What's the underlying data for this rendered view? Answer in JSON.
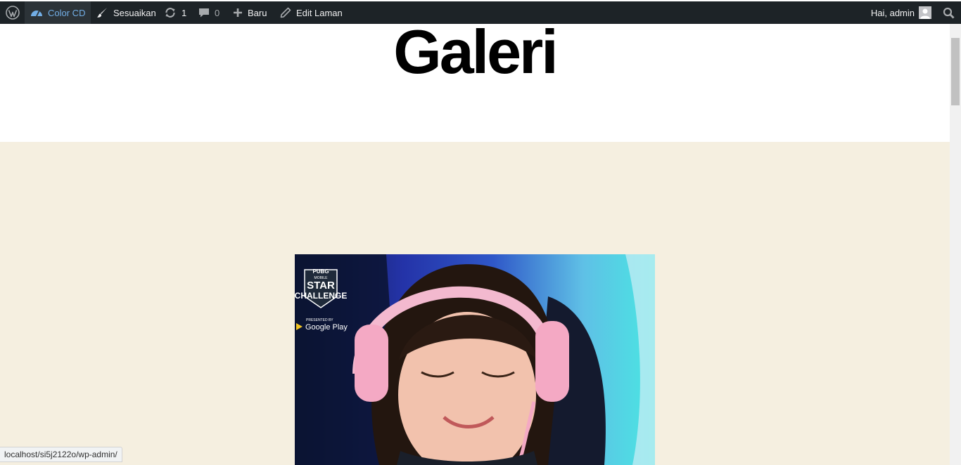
{
  "adminbar": {
    "site_name": "Color CD",
    "customize": "Sesuaikan",
    "updates_count": "1",
    "comments_count": "0",
    "new": "Baru",
    "edit_page": "Edit Laman",
    "greeting": "Hai, admin"
  },
  "page": {
    "title": "Galeri"
  },
  "gallery": {
    "image_text": {
      "line1": "PUBG",
      "line2": "MOBILE",
      "line3": "STAR",
      "line4": "CHALLENGE",
      "presented": "PRESENTED BY",
      "sponsor": "Google Play"
    }
  },
  "status_bar": {
    "url": "localhost/si5j2122o/wp-admin/"
  },
  "colors": {
    "adminbar_bg": "#1d2327",
    "accent": "#72aee6",
    "section_bg": "#f5efe0"
  }
}
